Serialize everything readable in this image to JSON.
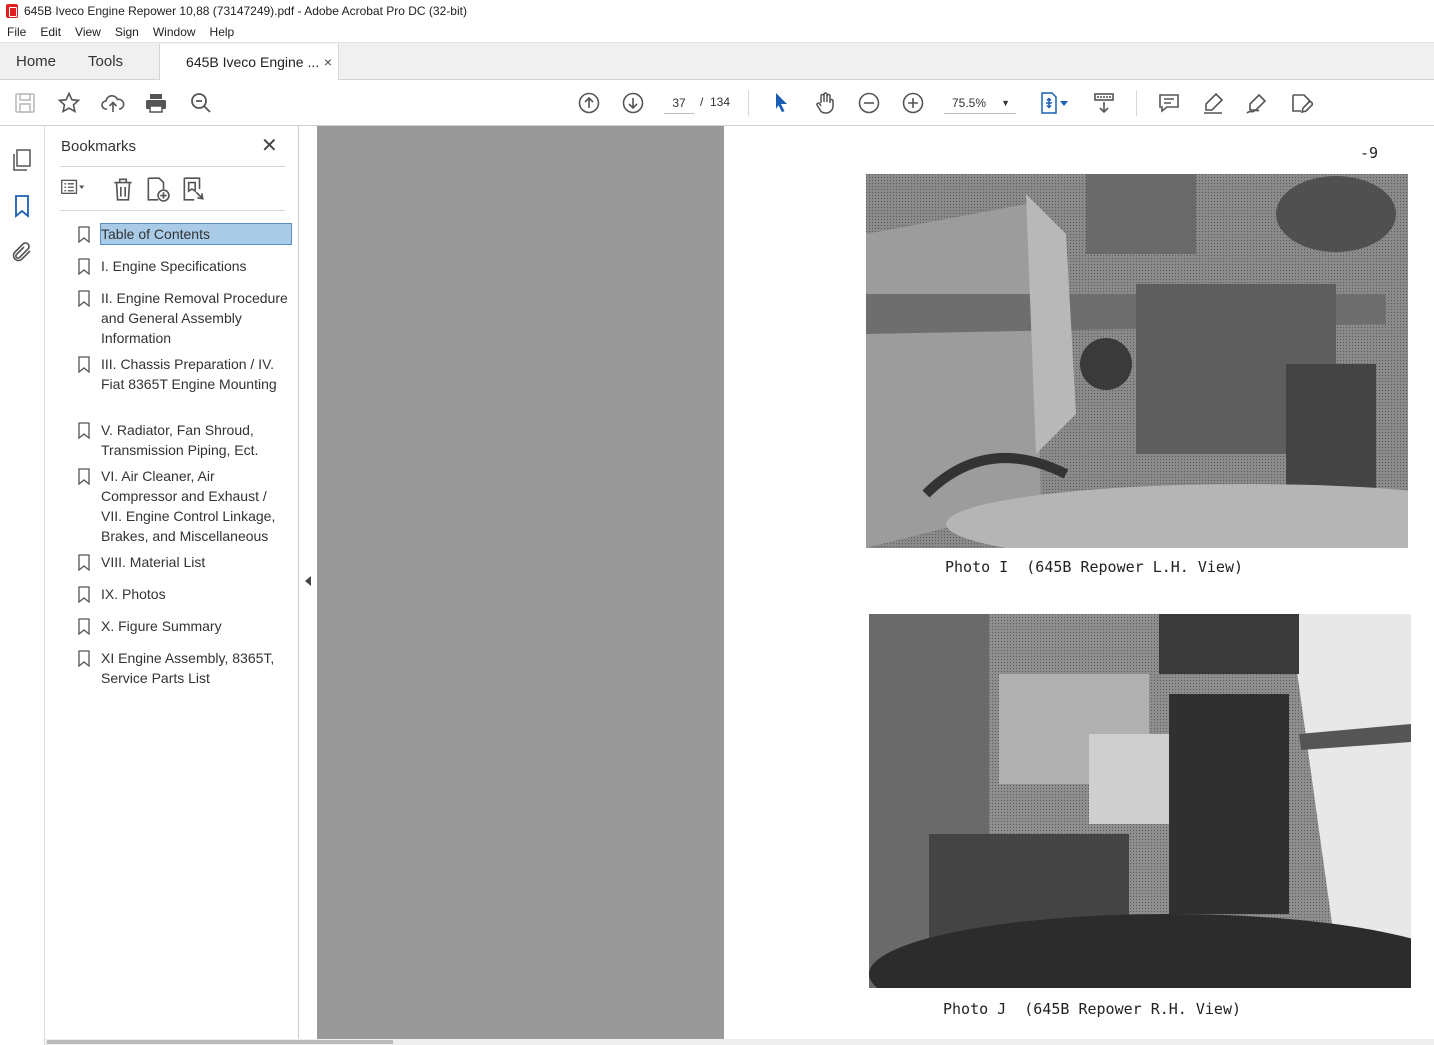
{
  "window": {
    "title": "645B Iveco Engine Repower 10,88 (73147249).pdf - Adobe Acrobat Pro DC (32-bit)"
  },
  "menu": [
    "File",
    "Edit",
    "View",
    "Sign",
    "Window",
    "Help"
  ],
  "tabs": {
    "home": "Home",
    "tools": "Tools",
    "document": "645B Iveco Engine ...",
    "close": "×"
  },
  "toolbar": {
    "icons": [
      "save-icon",
      "star-icon",
      "upload-icon",
      "print-icon",
      "search-zoom-icon",
      "page-up-icon",
      "page-down-icon",
      "select-pointer-icon",
      "hand-icon",
      "zoom-out-icon",
      "zoom-in-icon",
      "fit-page-icon",
      "scroll-mode-icon",
      "comment-icon",
      "highlight-icon",
      "sign-icon",
      "edit-icon"
    ],
    "current_page": "37",
    "separator": "/",
    "total_pages": "134",
    "zoom": "75.5%"
  },
  "bookmarks": {
    "header": "Bookmarks",
    "close": "✕",
    "items": [
      {
        "label": "Table of Contents",
        "selected": true
      },
      {
        "label": "I. Engine Specifications"
      },
      {
        "label": "II. Engine Removal Procedure and General Assembly Information"
      },
      {
        "label": "III. Chassis Preparation / IV. Fiat 8365T Engine Mounting"
      },
      {
        "label": "V. Radiator, Fan Shroud, Transmission Piping, Ect."
      },
      {
        "label": "VI. Air Cleaner, Air Compressor and Exhaust / VII. Engine Control Linkage, Brakes, and Miscellaneous"
      },
      {
        "label": "VIII. Material List"
      },
      {
        "label": "IX. Photos"
      },
      {
        "label": "X. Figure Summary"
      },
      {
        "label": "XI Engine Assembly, 8365T, Service Parts List"
      }
    ]
  },
  "document_page": {
    "page_number": "-9",
    "photo_i_caption": "Photo I  (645B Repower L.H. View)",
    "photo_j_caption": "Photo J  (645B Repower R.H. View)"
  }
}
